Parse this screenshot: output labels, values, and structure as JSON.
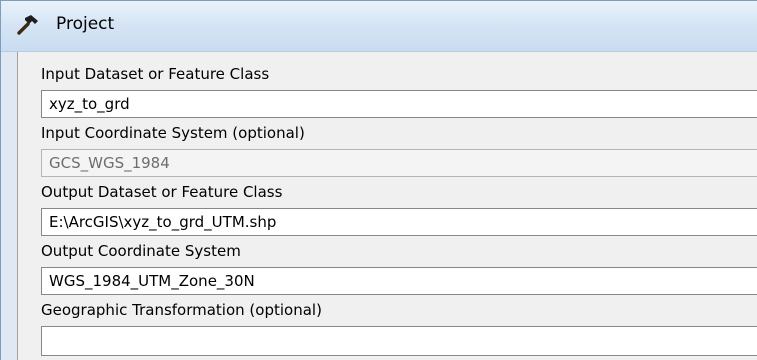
{
  "window": {
    "title": "Project",
    "icon": "hammer-icon"
  },
  "fields": [
    {
      "label": "Input Dataset or Feature Class",
      "value": "xyz_to_grd"
    },
    {
      "label": "Input Coordinate System (optional)",
      "value": "GCS_WGS_1984"
    },
    {
      "label": "Output Dataset or Feature Class",
      "value": "E:\\ArcGIS\\xyz_to_grd_UTM.shp"
    },
    {
      "label": "Output Coordinate System",
      "value": "WGS_1984_UTM_Zone_30N"
    },
    {
      "label": "Geographic Transformation (optional)",
      "value": ""
    }
  ]
}
